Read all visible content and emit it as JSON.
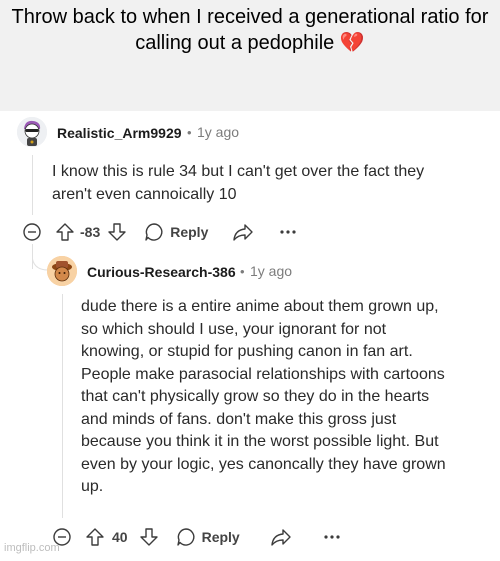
{
  "caption": {
    "text": "Throw back to when I received a generational ratio for calling out a pedophile",
    "emoji": "💔"
  },
  "comments": [
    {
      "username": "Realistic_Arm9929",
      "separator": "•",
      "time": "1y ago",
      "avatar_icon": "snoo-avatar-purple-hair-sunglasses",
      "body": "I know this is rule 34 but I can't get over the fact they\naren't even cannoically 10",
      "score": "-83",
      "reply_label": "Reply"
    },
    {
      "username": "Curious-Research-386",
      "separator": "•",
      "time": "1y ago",
      "avatar_icon": "snoo-avatar-orange-hat",
      "body": "dude there is a entire anime about them grown up,\nso which should I use, your ignorant for not\nknowing, or stupid for pushing canon in fan art.\nPeople make parasocial relationships with cartoons\nthat can't physically grow so they do in the hearts\nand minds of fans. don't make this gross just\nbecause you think it in the worst possible light. But\neven by your logic, yes canoncally they have grown\nup.",
      "score": "40",
      "reply_label": "Reply"
    }
  ],
  "watermark": "imgflip.com",
  "colors": {
    "caption_bg": "#f1f1f1",
    "text": "#2a2a2a",
    "muted": "#7c7c7c",
    "icon": "#3c3c3c"
  }
}
